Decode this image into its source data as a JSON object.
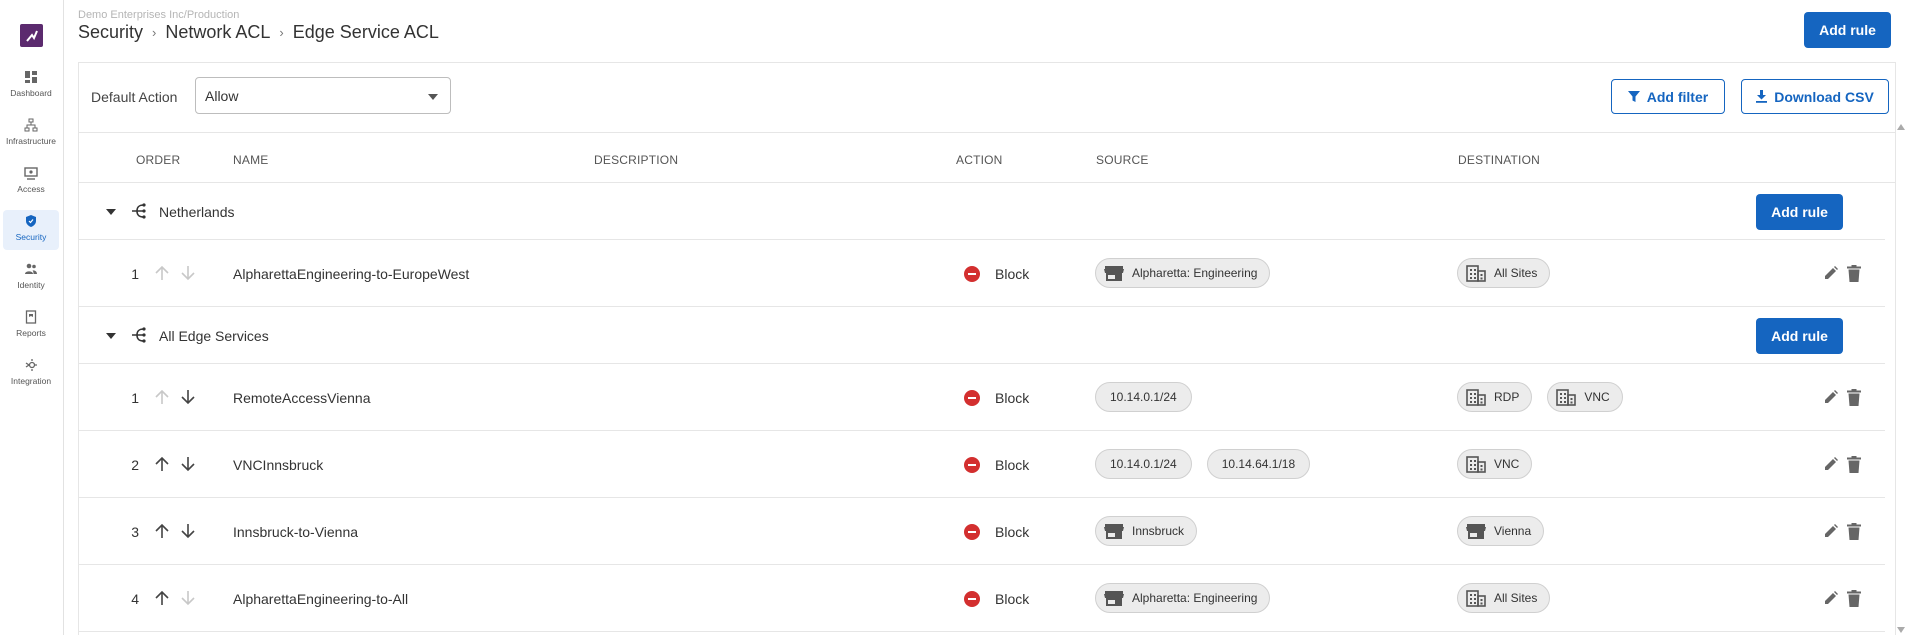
{
  "sidebar": {
    "items": [
      {
        "label": "Dashboard",
        "icon": "dashboard-icon"
      },
      {
        "label": "Infrastructure",
        "icon": "infrastructure-icon"
      },
      {
        "label": "Access",
        "icon": "access-icon"
      },
      {
        "label": "Security",
        "icon": "shield-icon",
        "active": true
      },
      {
        "label": "Identity",
        "icon": "people-icon"
      },
      {
        "label": "Reports",
        "icon": "report-icon"
      },
      {
        "label": "Integration",
        "icon": "integration-icon"
      }
    ]
  },
  "header": {
    "org": "Demo Enterprises Inc/Production",
    "breadcrumb": [
      "Security",
      "Network ACL",
      "Edge Service ACL"
    ],
    "add_rule_label": "Add rule"
  },
  "toolbar": {
    "default_action_label": "Default Action",
    "default_action_value": "Allow",
    "add_filter_label": "Add filter",
    "download_csv_label": "Download CSV"
  },
  "table": {
    "columns": [
      "ORDER",
      "NAME",
      "DESCRIPTION",
      "ACTION",
      "SOURCE",
      "DESTINATION"
    ],
    "groups": [
      {
        "name": "Netherlands",
        "add_rule_label": "Add rule",
        "rules": [
          {
            "order": "1",
            "name": "AlpharettaEngineering-to-EuropeWest",
            "description": "",
            "action": "Block",
            "source": [
              {
                "label": "Alpharetta: Engineering",
                "icon": "store-icon"
              }
            ],
            "destination": [
              {
                "label": "All Sites",
                "icon": "building-icon"
              }
            ]
          }
        ]
      },
      {
        "name": "All Edge Services",
        "add_rule_label": "Add rule",
        "rules": [
          {
            "order": "1",
            "name": "RemoteAccessVienna",
            "description": "",
            "action": "Block",
            "source": [
              {
                "label": "10.14.0.1/24"
              }
            ],
            "destination": [
              {
                "label": "RDP",
                "icon": "building-icon"
              },
              {
                "label": "VNC",
                "icon": "building-icon"
              }
            ]
          },
          {
            "order": "2",
            "name": "VNCInnsbruck",
            "description": "",
            "action": "Block",
            "source": [
              {
                "label": "10.14.0.1/24"
              },
              {
                "label": "10.14.64.1/18"
              }
            ],
            "destination": [
              {
                "label": "VNC",
                "icon": "building-icon"
              }
            ]
          },
          {
            "order": "3",
            "name": "Innsbruck-to-Vienna",
            "description": "",
            "action": "Block",
            "source": [
              {
                "label": "Innsbruck",
                "icon": "store-icon"
              }
            ],
            "destination": [
              {
                "label": "Vienna",
                "icon": "store-icon"
              }
            ]
          },
          {
            "order": "4",
            "name": "AlpharettaEngineering-to-All",
            "description": "",
            "action": "Block",
            "source": [
              {
                "label": "Alpharetta: Engineering",
                "icon": "store-icon"
              }
            ],
            "destination": [
              {
                "label": "All Sites",
                "icon": "building-icon"
              }
            ]
          }
        ]
      }
    ]
  },
  "colors": {
    "primary": "#1565c0",
    "block": "#d32f2f",
    "logo": "#5b2a6e",
    "chip_bg": "#ececec"
  }
}
